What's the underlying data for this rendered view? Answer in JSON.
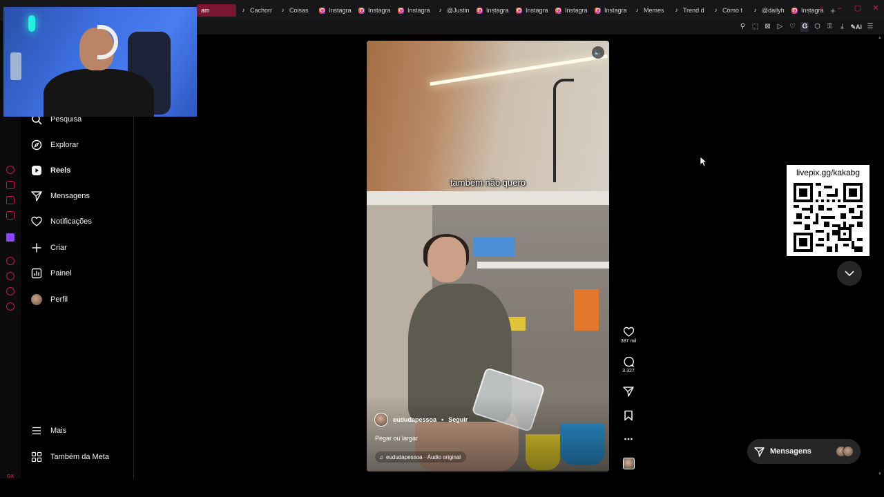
{
  "browser": {
    "tabs": [
      {
        "label": "am",
        "icon": "instagram-icon",
        "kind": "active"
      },
      {
        "label": "Cachorr",
        "icon": "tiktok-icon",
        "kind": "tt"
      },
      {
        "label": "Coisas",
        "icon": "tiktok-icon",
        "kind": "tt"
      },
      {
        "label": "Instagra",
        "icon": "instagram-icon",
        "kind": "ig"
      },
      {
        "label": "Instagra",
        "icon": "instagram-icon",
        "kind": "ig"
      },
      {
        "label": "Instagra",
        "icon": "instagram-icon",
        "kind": "ig"
      },
      {
        "label": "@Justin",
        "icon": "tiktok-icon",
        "kind": "tt"
      },
      {
        "label": "Instagra",
        "icon": "instagram-icon",
        "kind": "ig"
      },
      {
        "label": "Instagra",
        "icon": "instagram-icon",
        "kind": "ig"
      },
      {
        "label": "Instagra",
        "icon": "instagram-icon",
        "kind": "ig"
      },
      {
        "label": "Instagra",
        "icon": "instagram-icon",
        "kind": "ig"
      },
      {
        "label": "Memes",
        "icon": "tiktok-icon",
        "kind": "tt"
      },
      {
        "label": "Trend d",
        "icon": "tiktok-icon",
        "kind": "tt"
      },
      {
        "label": "Cómo t",
        "icon": "tiktok-icon",
        "kind": "tt"
      },
      {
        "label": "@dailyh",
        "icon": "tiktok-icon",
        "kind": "tt"
      },
      {
        "label": "Instagra",
        "icon": "instagram-icon",
        "kind": "ig"
      }
    ],
    "new_tab": "+",
    "extension_ai": "AI",
    "extension_g": "G",
    "accent": "#d0214d"
  },
  "nav": {
    "items": [
      {
        "label": "Pesquisa",
        "icon": "search-icon"
      },
      {
        "label": "Explorar",
        "icon": "compass-icon"
      },
      {
        "label": "Reels",
        "icon": "reels-icon",
        "active": true
      },
      {
        "label": "Mensagens",
        "icon": "send-icon"
      },
      {
        "label": "Notificações",
        "icon": "heart-icon"
      },
      {
        "label": "Criar",
        "icon": "plus-icon"
      },
      {
        "label": "Painel",
        "icon": "dashboard-icon"
      },
      {
        "label": "Perfil",
        "icon": "avatar"
      }
    ],
    "more": "Mais",
    "meta": "Também da Meta"
  },
  "reel": {
    "subtitle": "também não quero",
    "username": "eududapessoa",
    "separator": "•",
    "follow": "Seguir",
    "caption": "Pegar ou largar",
    "audio": "eududapessoa · Áudio original",
    "likes": "387 mil",
    "comments": "3.327"
  },
  "overlay": {
    "qr_label": "livepix.gg/kakabg"
  },
  "messages_pill": {
    "label": "Mensagens"
  }
}
